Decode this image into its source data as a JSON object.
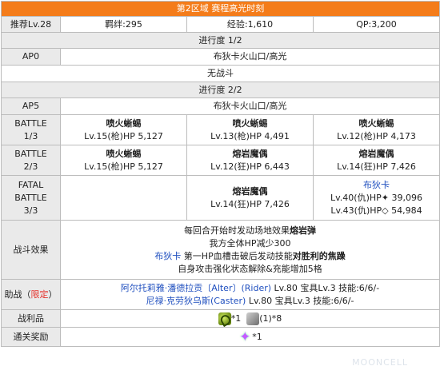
{
  "title": "第2区域 赛程高光时刻",
  "recommend": {
    "level": "推荐Lv.28",
    "bond": "羁绊:295",
    "exp": "经验:1,610",
    "qp": "QP:3,200"
  },
  "progress1": {
    "header": "进行度 1/2",
    "ap_label": "AP0",
    "location": "布狄卡火山口/高光",
    "no_battle": "无战斗"
  },
  "progress2": {
    "header": "进行度 2/2",
    "ap_label": "AP5",
    "location": "布狄卡火山口/高光",
    "battle1": {
      "label1": "BATTLE",
      "label2": "1/3",
      "e1": {
        "name": "喷火蜥蜴",
        "stats": "Lv.15(枪)HP 5,127"
      },
      "e2": {
        "name": "喷火蜥蜴",
        "stats": "Lv.13(枪)HP 4,491"
      },
      "e3": {
        "name": "喷火蜥蜴",
        "stats": "Lv.12(枪)HP 4,173"
      }
    },
    "battle2": {
      "label1": "BATTLE",
      "label2": "2/3",
      "e1": {
        "name": "喷火蜥蜴",
        "stats": "Lv.15(枪)HP 5,127"
      },
      "e2": {
        "name": "熔岩魔偶",
        "stats": "Lv.12(狂)HP 6,443"
      },
      "e3": {
        "name": "熔岩魔偶",
        "stats": "Lv.14(狂)HP 7,426"
      }
    },
    "battle3": {
      "label1": "FATAL",
      "label2": "BATTLE",
      "label3": "3/3",
      "e2": {
        "name": "熔岩魔偶",
        "stats": "Lv.14(狂)HP 7,426"
      },
      "e3": {
        "name": "布狄卡",
        "stats1": "Lv.40(仇)HP✦ 39,096",
        "stats2": "Lv.43(仇)HP◇ 54,984"
      }
    }
  },
  "effects": {
    "label": "战斗效果",
    "line1_a": "每回合开始时发动场地效果",
    "line1_b": "熔岩弹",
    "line2": "我方全体HP减少300",
    "line3_name": "布狄卡",
    "line3_a": " 第一HP血槽击破后发动技能",
    "line3_b": "对胜利的焦躁",
    "line4": "自身攻击强化状态解除&充能增加5格"
  },
  "support": {
    "label_a": "助战（",
    "label_b": "限定",
    "label_c": "）",
    "s1_name": "阿尔托莉雅·潘德拉贡〔Alter〕(Rider)",
    "s1_info": " Lv.80 宝具Lv.3 技能:6/6/-",
    "s2_name": "尼禄·克劳狄乌斯(Caster)",
    "s2_info": " Lv.80 宝具Lv.3 技能:6/6/-"
  },
  "loot": {
    "label": "战利品",
    "item1": "*1",
    "item2": "(1)*8"
  },
  "reward": {
    "label": "通关奖励",
    "item": "*1"
  },
  "watermark": "MOONCELL"
}
